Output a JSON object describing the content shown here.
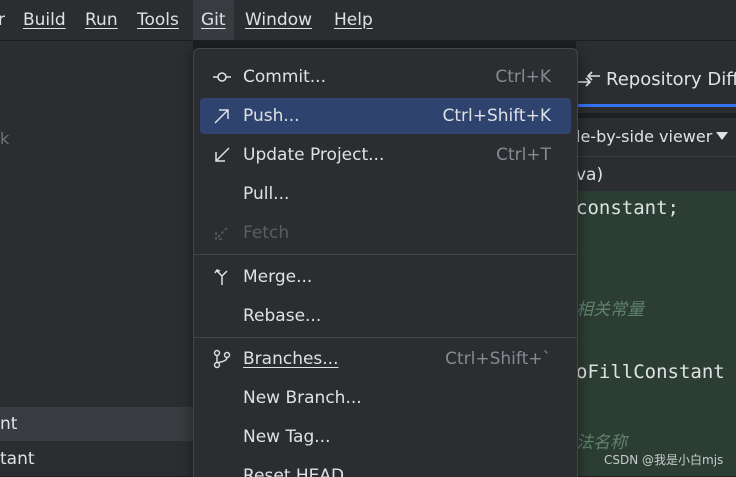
{
  "menubar": {
    "items": [
      {
        "label": "r"
      },
      {
        "label": "Build"
      },
      {
        "label": "Run"
      },
      {
        "label": "Tools"
      },
      {
        "label": "Git"
      },
      {
        "label": "Window"
      },
      {
        "label": "Help"
      }
    ]
  },
  "left_panel": {
    "stray_mark": "k",
    "rows": [
      {
        "label": "nt"
      },
      {
        "label": "tant"
      }
    ]
  },
  "editor": {
    "tab_title": "Repository Diff",
    "viewer_label": "le-by-side viewer",
    "file_row": "va)",
    "code_lines": [
      "constant;",
      "oFillConstant"
    ],
    "comments": [
      "相关常量",
      "法名称"
    ],
    "watermark": "CSDN @我是小白mjs"
  },
  "git_menu": {
    "commit": {
      "label": "Commit...",
      "shortcut": "Ctrl+K",
      "icon": "commit-icon"
    },
    "push": {
      "label": "Push...",
      "shortcut": "Ctrl+Shift+K",
      "icon": "push-arrow-icon"
    },
    "update": {
      "label": "Update Project...",
      "shortcut": "Ctrl+T",
      "icon": "update-arrow-icon"
    },
    "pull": {
      "label": "Pull..."
    },
    "fetch": {
      "label": "Fetch",
      "icon": "fetch-icon",
      "disabled": true
    },
    "merge": {
      "label": "Merge...",
      "icon": "merge-icon"
    },
    "rebase": {
      "label": "Rebase..."
    },
    "branches": {
      "label": "Branches...",
      "shortcut": "Ctrl+Shift+`",
      "icon": "branch-icon"
    },
    "new_branch": {
      "label": "New Branch..."
    },
    "new_tag": {
      "label": "New Tag..."
    },
    "reset_head": {
      "label": "Reset HEAD..."
    }
  },
  "colors": {
    "background": "#1e1f22",
    "panel": "#2b2d30",
    "hover": "#2e436e",
    "accent": "#3574f0",
    "diff_added": "#2c3d33",
    "comment": "#5f826b"
  }
}
